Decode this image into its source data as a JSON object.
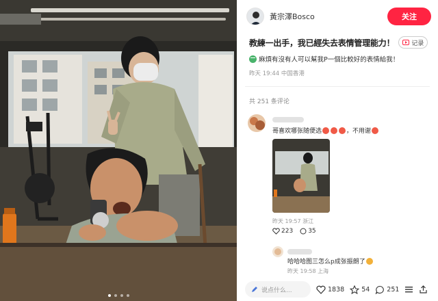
{
  "author": {
    "name": "黃宗澤Bosco",
    "follow_label": "关注"
  },
  "post": {
    "title": "教練一出手，我已經失去表情管理能力！",
    "tag_label": "记录",
    "body": "麻煩有沒有人可以幫我P一個比較好的表情給我！",
    "meta": "昨天 19:44 中国香港",
    "comment_count": "共 251 条评论"
  },
  "photo": {
    "page_indicator": {
      "total": 4,
      "active": 0
    }
  },
  "comments": [
    {
      "text": "哥喜欢哪张随便选",
      "text_suffix": "，不用谢",
      "meta": "昨天 19:57 浙江",
      "likes": "223",
      "replies": "35"
    },
    {
      "text": "哈哈哈图三怎么p成张振朗了",
      "meta": "昨天 19:58 上海"
    }
  ],
  "bottom_bar": {
    "input_placeholder": "说点什么...",
    "like_count": "1838",
    "collect_count": "54",
    "comment_count": "251"
  },
  "colors": {
    "accent": "#ff2442",
    "text": "#222222",
    "muted": "#999999"
  },
  "icons": [
    "avatar",
    "video-icon",
    "emoji-icon",
    "heart-icon",
    "star-icon",
    "comment-icon",
    "menu-icon",
    "share-icon",
    "pencil-icon"
  ]
}
